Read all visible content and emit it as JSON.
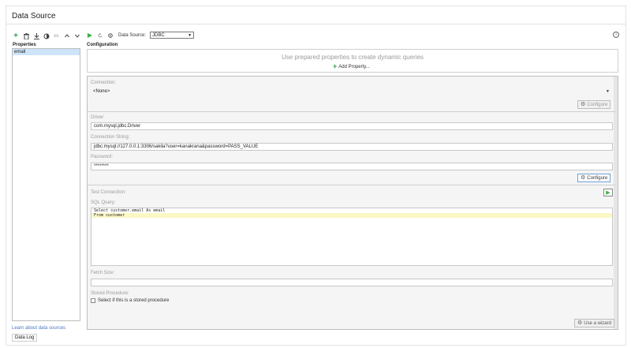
{
  "window": {
    "title": "Data Source"
  },
  "left_toolbar": {
    "icons": [
      "plus-icon",
      "trash-icon",
      "download-icon",
      "toggle-icon",
      "ellipsis-icon",
      "chevron-up-icon",
      "chevron-down-icon"
    ],
    "ellipsis_text": "xx."
  },
  "properties": {
    "header": "Properties",
    "items": [
      {
        "label": "email",
        "selected": true
      }
    ]
  },
  "links": {
    "learn": "Learn about data sources"
  },
  "buttons": {
    "data_log": "Data Log",
    "configure": "Configure",
    "use_wizard": "Use a wizard",
    "add_property": "Add Property..."
  },
  "right_toolbar": {
    "data_source_label": "Data Source:",
    "data_source_value": "JDBC",
    "info_symbol": "i"
  },
  "configuration": {
    "header": "Configuration",
    "dynamic_hint": "Use prepared properties to create dynamic queries",
    "connection": {
      "label": "Connection:",
      "value": "<None>"
    },
    "driver": {
      "label": "Driver:",
      "value": "com.mysql.jdbc.Driver"
    },
    "connection_string": {
      "label": "Connection String:",
      "value": "jdbc:mysql://127.0.0.1:3306/sakila?user=kanakrana&password=PASS_VALUE"
    },
    "password": {
      "label": "Password:",
      "value": "********"
    },
    "test_connection": {
      "label": "Test Connection:"
    },
    "sql_query": {
      "label": "SQL Query:",
      "lines": [
        "Select customer.email As email",
        "From customer"
      ]
    },
    "fetch_size": {
      "label": "Fetch Size:",
      "value": ""
    },
    "stored_procedure": {
      "label": "Stored Procedure:",
      "checkbox_label": "Select if this is a stored procedure",
      "checked": false
    }
  },
  "colors": {
    "accent_green": "#2ea043",
    "selection_blue": "#cde3f7",
    "sql_highlight": "#fbf8c6",
    "link_blue": "#4a78c2"
  }
}
